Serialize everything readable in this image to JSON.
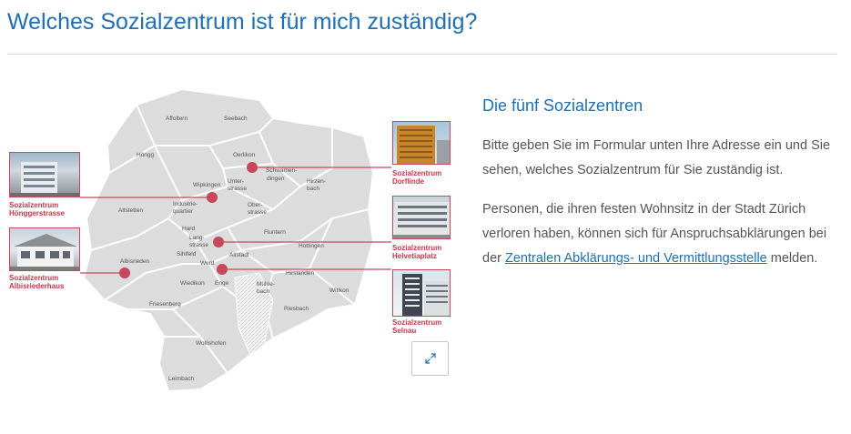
{
  "page": {
    "title": "Welches Sozialzentrum ist für mich zuständig?"
  },
  "map": {
    "districts": [
      "Affoltern",
      "Seebach",
      "Höngg",
      "Oerlikon",
      "Schwamen-",
      "dingen",
      "Wipkingen",
      "Unter-",
      "strasse",
      "Hirzen-",
      "bach",
      "Altstetten",
      "Industrie-",
      "quartier",
      "Ober-",
      "strasse",
      "Hard",
      "Fluntern",
      "Lang-",
      "strasse",
      "Hottingen",
      "Sihlfeld",
      "Altstadt",
      "Albisrieden",
      "Werd",
      "Hirslanden",
      "Wiedikon",
      "Enge",
      "Mühle-",
      "bach",
      "Witikon",
      "Friesenberg",
      "Riesbach",
      "Wollishofen",
      "Leimbach"
    ],
    "centers": [
      {
        "line1": "Sozialzentrum",
        "line2": "Hönggerstrasse"
      },
      {
        "line1": "Sozialzentrum",
        "line2": "Albisriederhaus"
      },
      {
        "line1": "Sozialzentrum",
        "line2": "Dorflinde"
      },
      {
        "line1": "Sozialzentrum",
        "line2": "Helvetiaplatz"
      },
      {
        "line1": "Sozialzentrum",
        "line2": "Selnau"
      }
    ],
    "expand_icon": "expand-arrows-icon",
    "colors": {
      "marker": "#c7485a",
      "map_fill": "#d9d9d9",
      "title": "#1f6fb2"
    }
  },
  "info": {
    "heading": "Die fünf Sozialzentren",
    "p1": "Bitte geben Sie im Formular unten Ihre Adresse ein und Sie sehen, welches Sozialzentrum für Sie zuständig ist.",
    "p2_before": "Personen, die ihren festen Wohnsitz in der Stadt Zürich verloren haben, können sich für Anspruchsabklärungen bei der",
    "p2_link": "Zentralen Abklärungs- und Vermittlungsstelle",
    "p2_after": " melden."
  }
}
